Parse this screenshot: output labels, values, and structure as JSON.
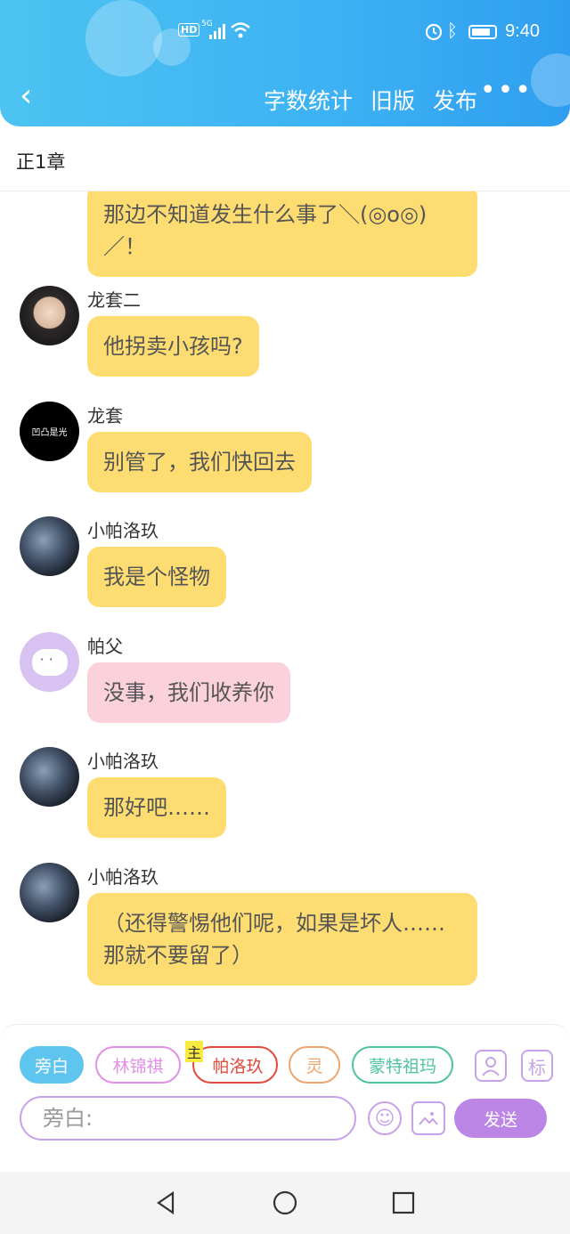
{
  "status_bar": {
    "hd": "HD",
    "signal": "5G",
    "time": "9:40"
  },
  "nav": {
    "back": "‹",
    "word_count": "字数统计",
    "old_version": "旧版",
    "publish": "发布",
    "more": "•••"
  },
  "chapter": "正1章",
  "messages": [
    {
      "name": "",
      "avatar": "avatar-black",
      "text": "那边不知道发生什么事了＼(◎o◎)／！",
      "style": "yellow"
    },
    {
      "name": "龙套二",
      "avatar": "avatar-girl",
      "text": "他拐卖小孩吗?",
      "style": "yellow"
    },
    {
      "name": "龙套",
      "avatar": "avatar-black",
      "avatar_text": "凹凸是光",
      "text": "别管了，我们快回去",
      "style": "yellow"
    },
    {
      "name": "小帕洛玖",
      "avatar": "avatar-dark",
      "text": "我是个怪物",
      "style": "yellow"
    },
    {
      "name": "帕父",
      "avatar": "avatar-ghost",
      "text": "没事，我们收养你",
      "style": "pink"
    },
    {
      "name": "小帕洛玖",
      "avatar": "avatar-dark",
      "text": "那好吧……",
      "style": "yellow"
    },
    {
      "name": "小帕洛玖",
      "avatar": "avatar-dark",
      "text": "（还得警惕他们呢，如果是坏人……那就不要留了）",
      "style": "yellow"
    }
  ],
  "roles": [
    {
      "label": "旁白",
      "color": "#5ec6ee",
      "active": true
    },
    {
      "label": "林锦祺",
      "color": "#e28fe8",
      "active": false
    },
    {
      "label": "帕洛玖",
      "color": "#e04b3c",
      "active": false,
      "badge": "主"
    },
    {
      "label": "灵",
      "color": "#f0a56f",
      "active": false
    },
    {
      "label": "蒙特祖玛",
      "color": "#4fc3a1",
      "active": false
    }
  ],
  "tools": {
    "person_icon": "person-icon",
    "mark": "标"
  },
  "input": {
    "placeholder": "旁白:"
  },
  "send": "发送",
  "colors": {
    "header": "#3cb1f3",
    "bubble": "#fddc72",
    "bubble_pink": "#fbd1dc",
    "accent": "#bb86e6"
  }
}
